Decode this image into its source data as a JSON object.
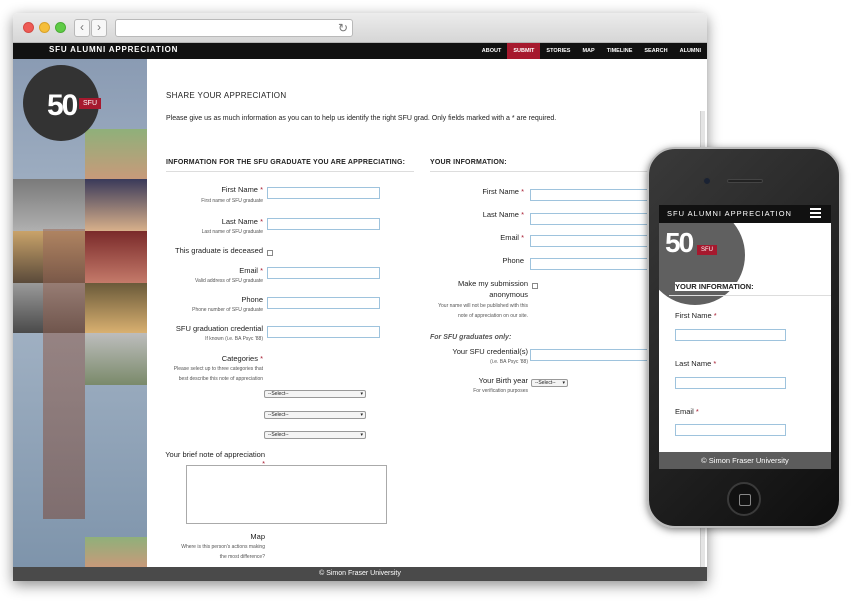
{
  "site": {
    "title": "SFU ALUMNI APPRECIATION",
    "nav": [
      "ABOUT",
      "SUBMIT",
      "STORIES",
      "MAP",
      "TIMELINE",
      "SEARCH",
      "ALUMNI"
    ],
    "active_nav": "SUBMIT",
    "logo_number": "50",
    "logo_text": "SFU"
  },
  "page": {
    "heading": "SHARE YOUR APPRECIATION",
    "intro": "Please give us as much information as you can to help us identify the right SFU grad. Only fields marked with a * are required."
  },
  "graduate_section": {
    "title": "INFORMATION FOR THE SFU GRADUATE YOU ARE APPRECIATING:",
    "first_name": {
      "label": "First Name",
      "hint": "First name of SFU graduate"
    },
    "last_name": {
      "label": "Last Name",
      "hint": "Last name of SFU graduate"
    },
    "deceased": {
      "label": "This graduate is deceased"
    },
    "email": {
      "label": "Email",
      "hint": "Valid address of SFU graduate"
    },
    "phone": {
      "label": "Phone",
      "hint": "Phone number of SFU graduate"
    },
    "credential": {
      "label": "SFU graduation credential",
      "hint": "If known (i.e. BA Psyc '88)"
    },
    "categories": {
      "label": "Categories",
      "hint_line1": "Please select up to three categories that",
      "hint_line2": "best describe this note of appreciation",
      "select_values": [
        "--Select--",
        "--Select--",
        "--Select--"
      ]
    },
    "note": {
      "label": "Your brief note of appreciation"
    },
    "map": {
      "label": "Map",
      "hint_line1": "Where is this person's actions making",
      "hint_line2": "the most difference?"
    }
  },
  "your_section": {
    "title": "YOUR INFORMATION:",
    "first_name": {
      "label": "First Name"
    },
    "last_name": {
      "label": "Last Name"
    },
    "email": {
      "label": "Email"
    },
    "phone": {
      "label": "Phone"
    },
    "anonymous": {
      "label_line1": "Make my submission",
      "label_line2": "anonymous",
      "hint_line1": "Your name will not be published with this",
      "hint_line2": "note of appreciation on our site."
    },
    "grads_only": "For SFU graduates only:",
    "credentials": {
      "label": "Your SFU credential(s)",
      "hint": "(i.e. BA Psyc '88)"
    },
    "birth_year": {
      "label": "Your Birth year",
      "hint": "For verification purposes",
      "value": "--Select--"
    }
  },
  "required_marker": "*",
  "footer": "© Simon Fraser University",
  "mobile": {
    "title": "SFU ALUMNI APPRECIATION",
    "logo_number": "50",
    "logo_text": "SFU",
    "section_title": "YOUR INFORMATION:",
    "fields": [
      "First Name",
      "Last Name",
      "Email"
    ],
    "footer": "© Simon Fraser University"
  },
  "colors": {
    "brand_red": "#a6192e",
    "bar_dark": "#111111",
    "footer_gray": "#4a4a4a",
    "input_border": "#9ec3dd"
  }
}
